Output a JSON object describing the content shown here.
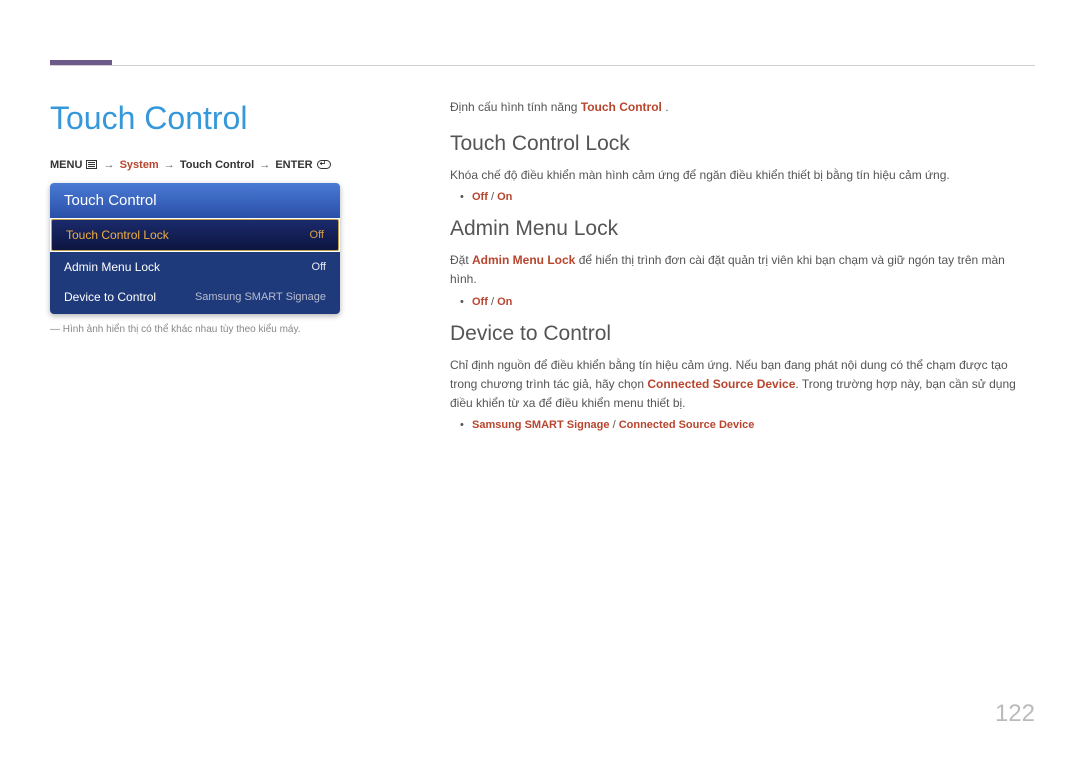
{
  "page": {
    "title": "Touch Control",
    "number": "122"
  },
  "breadcrumb": {
    "menu": "MENU",
    "system": "System",
    "touch_control": "Touch Control",
    "enter": "ENTER"
  },
  "osd": {
    "header": "Touch Control",
    "items": [
      {
        "label": "Touch Control Lock",
        "value": "Off"
      },
      {
        "label": "Admin Menu Lock",
        "value": "Off"
      },
      {
        "label": "Device to Control",
        "value": "Samsung SMART Signage"
      }
    ]
  },
  "footnote": "― Hình ảnh hiển thị có thể khác nhau tùy theo kiểu máy.",
  "intro": {
    "pre": "Định cấu hình tính năng ",
    "hl": "Touch Control",
    "post": " ."
  },
  "sections": {
    "tcl": {
      "heading": "Touch Control Lock",
      "body": "Khóa chế độ điều khiển màn hình cảm ứng để ngăn điều khiển thiết bị bằng tín hiệu cảm ứng.",
      "opt1": "Off",
      "sep": " / ",
      "opt2": "On"
    },
    "aml": {
      "heading": "Admin Menu Lock",
      "body_pre": "Đặt ",
      "body_hl": "Admin Menu Lock",
      "body_post": " để hiển thị trình đơn cài đặt quản trị viên khi bạn chạm và giữ ngón tay trên màn hình.",
      "opt1": "Off",
      "sep": " / ",
      "opt2": "On"
    },
    "dtc": {
      "heading": "Device to Control",
      "body_pre": "Chỉ định nguồn để điều khiển bằng tín hiệu cảm ứng. Nếu bạn đang phát nội dung có thể chạm được tạo trong chương trình tác giả, hãy chọn ",
      "body_hl": "Connected Source Device",
      "body_post": ". Trong trường hợp này, bạn cần sử dụng điều khiển từ xa để điều khiển menu thiết bị.",
      "opt1": "Samsung SMART Signage",
      "sep": " / ",
      "opt2": "Connected Source Device"
    }
  }
}
